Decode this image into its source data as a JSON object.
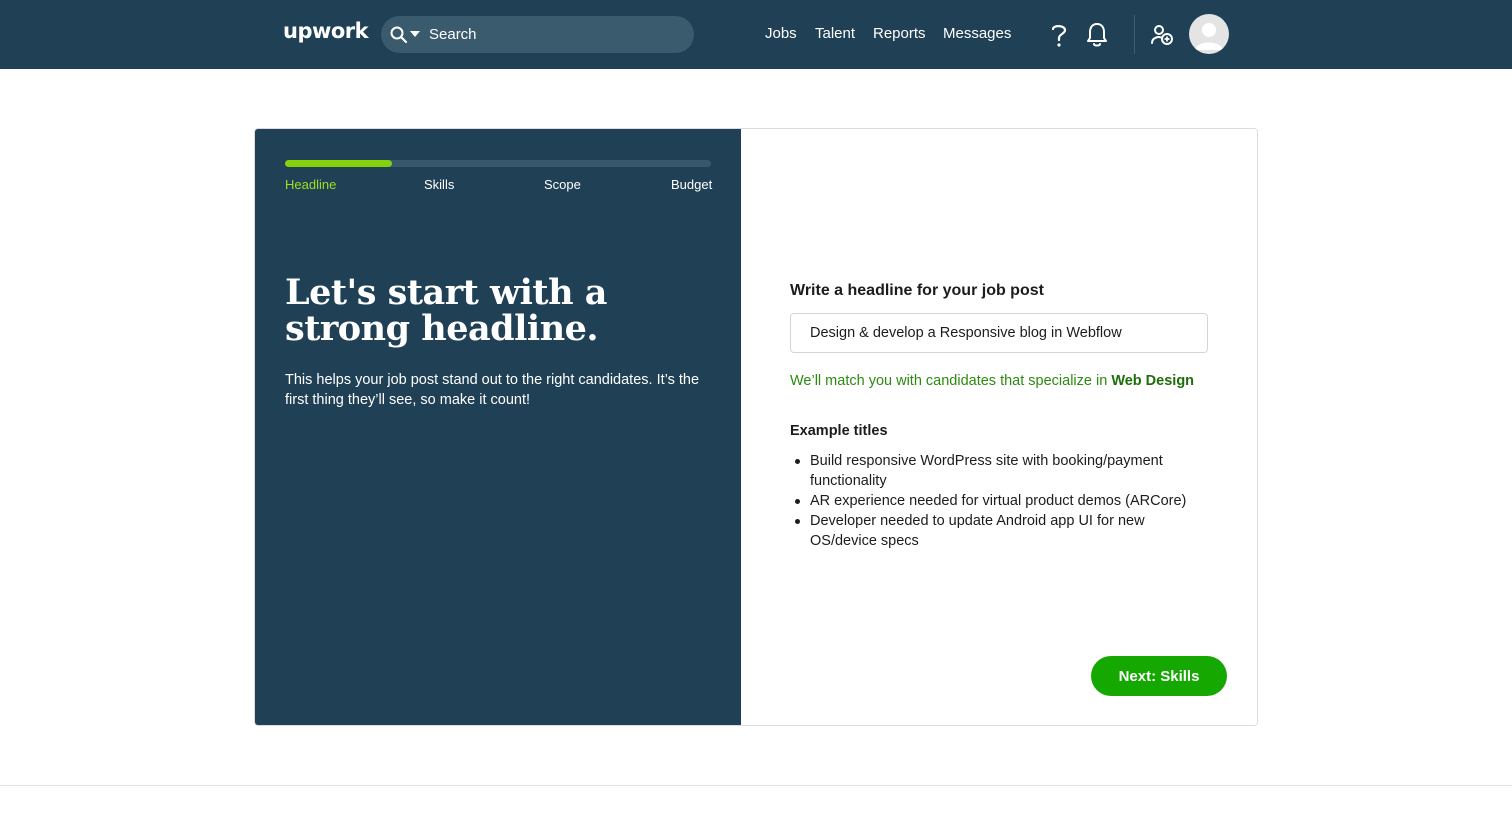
{
  "header": {
    "logo": "upwork",
    "search": {
      "placeholder": "Search"
    },
    "nav": [
      "Jobs",
      "Talent",
      "Reports",
      "Messages"
    ],
    "icons": [
      "help-icon",
      "bell-icon",
      "add-user-icon",
      "avatar-icon"
    ]
  },
  "progress": {
    "fraction": 0.25,
    "steps": [
      "Headline",
      "Skills",
      "Scope",
      "Budget"
    ],
    "active_step": "Headline"
  },
  "intro": {
    "title": "Let's start with a strong headline.",
    "subtitle": "This helps your job post stand out to the right candidates. It’s the first thing they’ll see, so make it count!"
  },
  "form": {
    "label": "Write a headline for your job post",
    "headline_value": "Design & develop a Responsive blog in Webflow",
    "match_prefix": "We’ll match you with candidates that specialize in ",
    "match_category": "Web Design",
    "examples_label": "Example titles",
    "examples": [
      "Build responsive WordPress site with booking/payment functionality",
      "AR experience needed for virtual product demos (ARCore)",
      "Developer needed to update Android app UI for new OS/device specs"
    ]
  },
  "actions": {
    "next_label": "Next: Skills"
  },
  "colors": {
    "navy": "#1f4055",
    "accent_green": "#14a800",
    "progress_green": "#84d20b"
  }
}
